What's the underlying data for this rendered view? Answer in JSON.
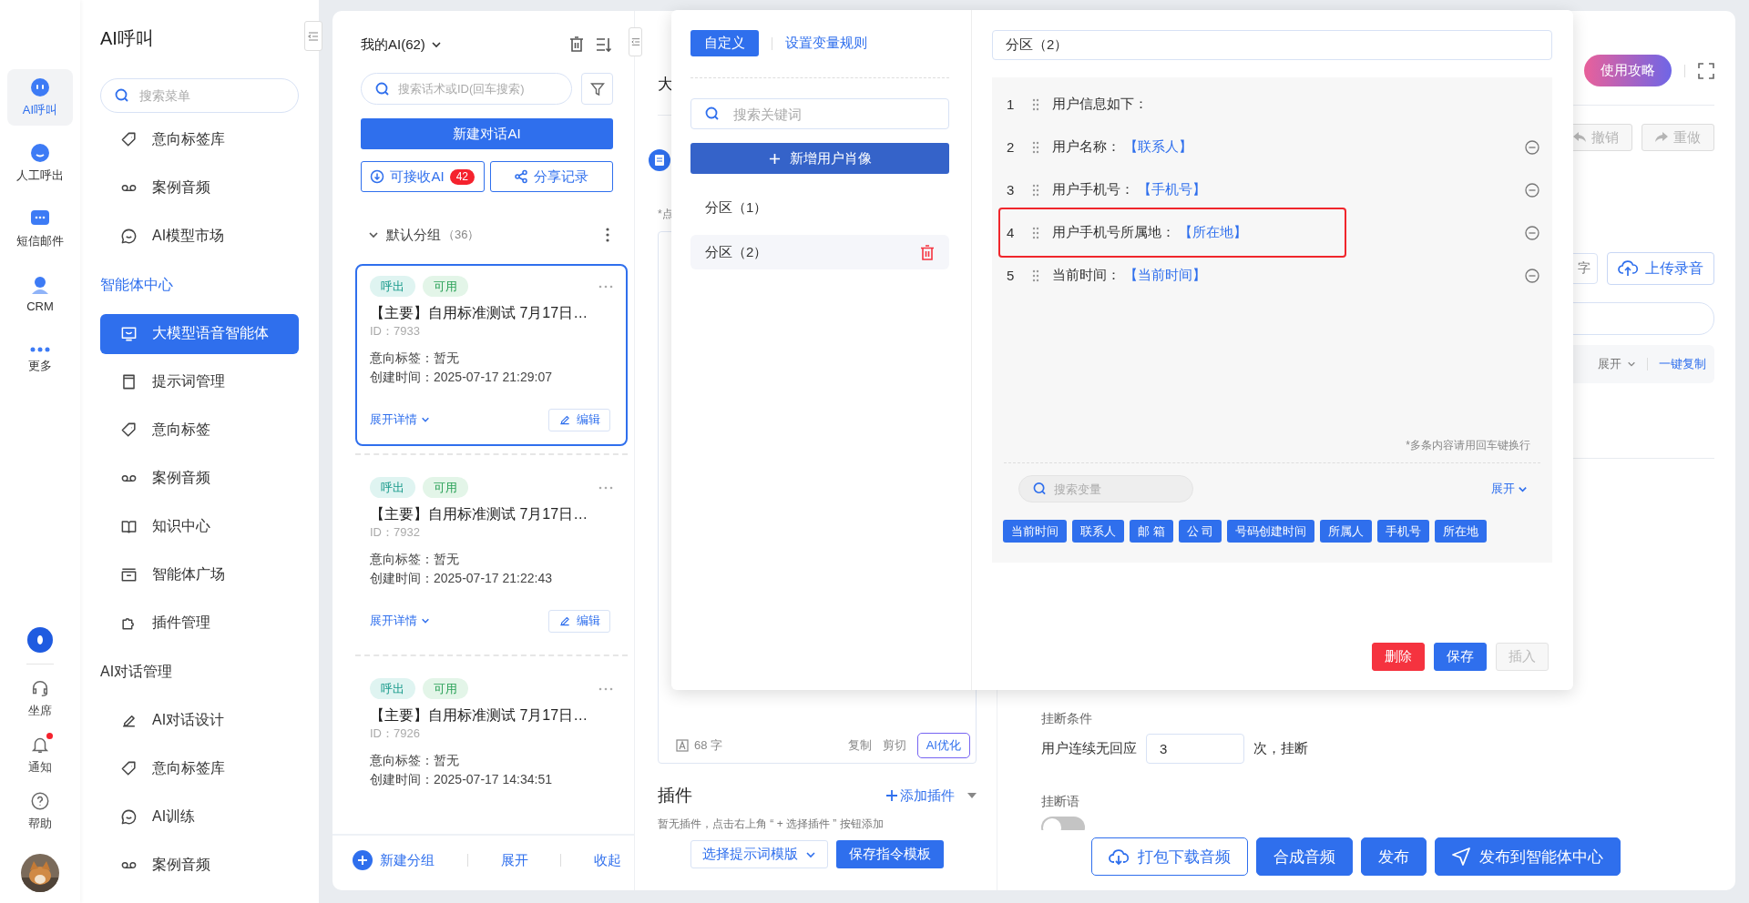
{
  "nav_rail": {
    "items": [
      {
        "label": "AI呼叫",
        "kind": "bot",
        "selected": true
      },
      {
        "label": "人工呼出",
        "kind": "smile",
        "selected": false
      },
      {
        "label": "短信邮件",
        "kind": "message",
        "selected": false
      },
      {
        "label": "CRM",
        "kind": "person",
        "selected": false
      },
      {
        "label": "更多",
        "kind": "more",
        "selected": false
      }
    ],
    "bottom_items": [
      {
        "label": "坐席",
        "kind": "headset",
        "badge": false
      },
      {
        "label": "通知",
        "kind": "bell",
        "badge": true
      },
      {
        "label": "帮助",
        "kind": "help",
        "badge": false
      }
    ]
  },
  "sidebar": {
    "title": "AI呼叫",
    "search_placeholder": "搜索菜单",
    "sections": [
      {
        "items": [
          {
            "label": "意向标签库",
            "kind": "tag",
            "selected": false
          },
          {
            "label": "案例音频",
            "kind": "voicemail",
            "selected": false
          },
          {
            "label": "AI模型市场",
            "kind": "chat",
            "selected": false
          }
        ]
      },
      {
        "heading": "智能体中心",
        "active": true,
        "items": [
          {
            "label": "大模型语音智能体",
            "kind": "screen",
            "selected": true
          },
          {
            "label": "提示词管理",
            "kind": "card",
            "selected": false
          },
          {
            "label": "意向标签",
            "kind": "tag",
            "selected": false
          },
          {
            "label": "案例音频",
            "kind": "voicemail",
            "selected": false
          },
          {
            "label": "知识中心",
            "kind": "book",
            "selected": false
          },
          {
            "label": "智能体广场",
            "kind": "tray",
            "selected": false
          },
          {
            "label": "插件管理",
            "kind": "puzzle",
            "selected": false
          }
        ]
      },
      {
        "heading": "AI对话管理",
        "active": false,
        "items": [
          {
            "label": "AI对话设计",
            "kind": "pen",
            "selected": false
          },
          {
            "label": "意向标签库",
            "kind": "tag",
            "selected": false
          },
          {
            "label": "AI训练",
            "kind": "chat",
            "selected": false
          },
          {
            "label": "案例音频",
            "kind": "voicemail",
            "selected": false
          }
        ]
      }
    ]
  },
  "ai_list": {
    "title": "我的AI(62)",
    "search_placeholder": "搜索话术或ID(回车搜索)",
    "new_button": "新建对话AI",
    "receive_button": {
      "label": "可接收AI",
      "count": "42"
    },
    "share_button": "分享记录",
    "group": {
      "label": "默认分组",
      "count": "（36）",
      "expanded": true
    },
    "cards": [
      {
        "tags": [
          {
            "label": "呼出",
            "kind": "direction"
          },
          {
            "label": "可用",
            "kind": "status"
          }
        ],
        "title": "【主要】自用标准测试 7月17日…",
        "id": "ID：7933",
        "intent": "意向标签：暂无",
        "created": "创建时间：2025-07-17 21:29:07",
        "expand_label": "展开详情",
        "edit_label": "编辑",
        "selected": true
      },
      {
        "tags": [
          {
            "label": "呼出",
            "kind": "direction"
          },
          {
            "label": "可用",
            "kind": "status"
          }
        ],
        "title": "【主要】自用标准测试 7月17日…",
        "id": "ID：7932",
        "intent": "意向标签：暂无",
        "created": "创建时间：2025-07-17 21:22:43",
        "expand_label": "展开详情",
        "edit_label": "编辑",
        "selected": false
      },
      {
        "tags": [
          {
            "label": "呼出",
            "kind": "direction"
          },
          {
            "label": "可用",
            "kind": "status"
          }
        ],
        "title": "【主要】自用标准测试 7月17日…",
        "id": "ID：7926",
        "intent": "意向标签：暂无",
        "created": "创建时间：2025-07-17 14:34:51",
        "selected": false
      }
    ],
    "footer": {
      "new_group": "新建分组",
      "expand": "展开",
      "collapse": "收起"
    }
  },
  "editor": {
    "title_fragment": "大",
    "note_fragment": "*点",
    "char_count": "68 字",
    "copy": "复制",
    "cut": "剪切",
    "optimize": "AI优化",
    "plugins": {
      "title": "插件",
      "add": "添加插件",
      "empty": "暂无插件，点击右上角 “ + 选择插件 ” 按钮添加"
    },
    "template_select": "选择提示词模版",
    "save_template": "保存指令模板"
  },
  "right_panel": {
    "guide_button": "使用攻略",
    "undo": {
      "label": "撤销",
      "disabled": true
    },
    "redo": {
      "label": "重做",
      "disabled": true
    },
    "convert_fragment": "字",
    "upload": "上传录音",
    "expand": "展开",
    "copy_all": "一键复制",
    "hangup": {
      "title": "挂断条件",
      "prefix": "用户连续无回应",
      "value": "3",
      "suffix": "次，挂断"
    },
    "hangup_speech": {
      "title": "挂断语",
      "on": false
    },
    "actions": [
      {
        "label": "打包下载音频",
        "kind": "download"
      },
      {
        "label": "合成音频",
        "kind": "plain"
      },
      {
        "label": "发布",
        "kind": "plain"
      },
      {
        "label": "发布到智能体中心",
        "kind": "send"
      }
    ]
  },
  "profile_dialog": {
    "tabs": [
      {
        "label": "自定义",
        "selected": true
      },
      {
        "label": "设置变量规则",
        "selected": false
      }
    ],
    "search_placeholder": "搜索关键词",
    "add_button": "新增用户肖像",
    "sections": [
      {
        "label": "分区（1）",
        "selected": false
      },
      {
        "label": "分区（2）",
        "selected": true
      }
    ],
    "name_value": "分区（2）",
    "lines": [
      {
        "number": "1",
        "text": "用户信息如下：",
        "removable": false,
        "highlighted": false
      },
      {
        "number": "2",
        "text": "用户名称：",
        "variable": "【联系人】",
        "removable": true,
        "highlighted": false
      },
      {
        "number": "3",
        "text": "用户手机号：",
        "variable": "【手机号】",
        "removable": true,
        "highlighted": false
      },
      {
        "number": "4",
        "text": "用户手机号所属地：",
        "variable": "【所在地】",
        "removable": true,
        "highlighted": true
      },
      {
        "number": "5",
        "text": "当前时间：",
        "variable": "【当前时间】",
        "removable": true,
        "highlighted": false
      }
    ],
    "hint": "*多条内容请用回车键换行",
    "variable_search_placeholder": "搜索变量",
    "expand": "展开",
    "variables": [
      "当前时间",
      "联系人",
      "邮 箱",
      "公 司",
      "号码创建时间",
      "所属人",
      "手机号",
      "所在地"
    ],
    "buttons": [
      {
        "label": "删除",
        "kind": "danger"
      },
      {
        "label": "保存",
        "kind": "primary"
      },
      {
        "label": "插入",
        "kind": "disabled"
      }
    ]
  }
}
